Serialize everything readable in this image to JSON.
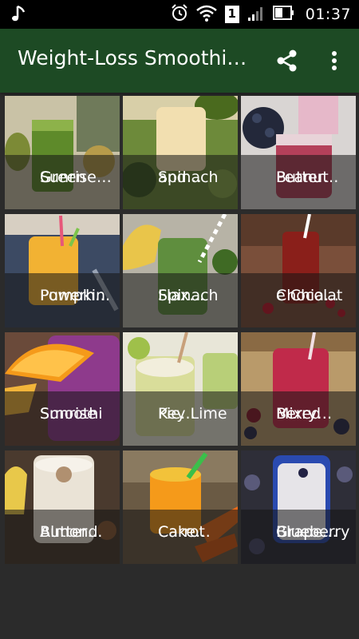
{
  "status_bar": {
    "time": "01:37",
    "sim_badge": "1",
    "icons": [
      "music-note-icon",
      "alarm-icon",
      "wifi-icon",
      "sim-icon",
      "signal-icon",
      "battery-icon"
    ]
  },
  "app_bar": {
    "title": "Weight-Loss Smoothi…",
    "actions": [
      "share-icon",
      "more-vert-icon"
    ],
    "color": "#1d4a24"
  },
  "recipes": [
    {
      "line1": "Green",
      "line2": "Sunrise…"
    },
    {
      "line1": "Spinach",
      "line2": "and…"
    },
    {
      "line1": "Peanut",
      "line2": "Butter…"
    },
    {
      "line1": "Pumpkin",
      "line2": "Powerh…"
    },
    {
      "line1": "Spinach",
      "line2": "Flax…"
    },
    {
      "line1": "Chocolat",
      "line2": "e Chia…"
    },
    {
      "line1": "Sunrise",
      "line2": "Smoothi"
    },
    {
      "line1": "Key Lime",
      "line2": "Pie…"
    },
    {
      "line1": "Mixed",
      "line2": "Berry…"
    },
    {
      "line1": "Almond",
      "line2": "Butter…"
    },
    {
      "line1": "Carrot",
      "line2": "Cake…"
    },
    {
      "line1": "Blueberry",
      "line2": "Grape…"
    }
  ]
}
